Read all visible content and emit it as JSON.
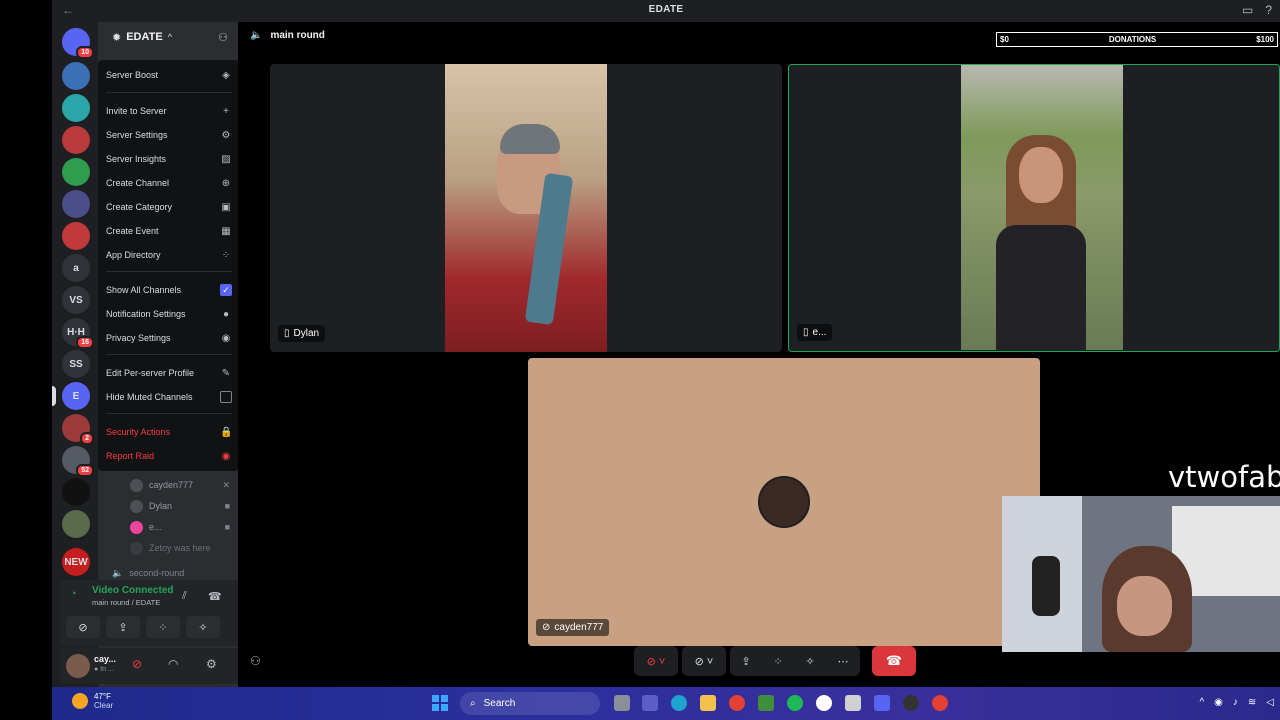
{
  "titlebar": {
    "title": "EDATE",
    "back": "←",
    "forward": "→",
    "inbox_icon": "inbox-icon",
    "help": "?"
  },
  "guilds": {
    "items": [
      {
        "label": "",
        "badge": "10",
        "color": "#5865f2"
      },
      {
        "label": "",
        "color": "#3b6fb6"
      },
      {
        "label": "",
        "color": "#2aa6a8"
      },
      {
        "label": "",
        "color": "#b83a3a"
      },
      {
        "label": "",
        "color": "#2e9e4e"
      },
      {
        "label": "",
        "color": "#4a4f8a"
      },
      {
        "label": "",
        "color": "#c23b3b"
      },
      {
        "label": "a"
      },
      {
        "label": "VS"
      },
      {
        "label": "H·H",
        "badge": "16"
      },
      {
        "label": "SS"
      },
      {
        "label": "E",
        "color": "#5865f2"
      },
      {
        "label": "",
        "badge": "2",
        "color": "#9c3a3a"
      },
      {
        "label": "",
        "badge": "52",
        "color": "#555a65"
      },
      {
        "label": "",
        "color": "#111"
      },
      {
        "label": "",
        "color": "#5a6b4a"
      },
      {
        "label": "NEW",
        "color": "#c41e1e"
      }
    ]
  },
  "server": {
    "name": "EDATE",
    "caret": "^"
  },
  "menu": {
    "items": [
      {
        "label": "Server Boost",
        "icon": "◈"
      },
      {
        "label": "Invite to Server",
        "icon": "+"
      },
      {
        "label": "Server Settings",
        "icon": "⚙"
      },
      {
        "label": "Server Insights",
        "icon": "▨"
      },
      {
        "label": "Create Channel",
        "icon": "⊕"
      },
      {
        "label": "Create Category",
        "icon": "▣"
      },
      {
        "label": "Create Event",
        "icon": "▦"
      },
      {
        "label": "App Directory",
        "icon": "⁘"
      },
      {
        "label": "Show All Channels",
        "checked": true
      },
      {
        "label": "Notification Settings",
        "icon": "●"
      },
      {
        "label": "Privacy Settings",
        "icon": "◉"
      },
      {
        "label": "Edit Per-server Profile",
        "icon": "✎"
      },
      {
        "label": "Hide Muted Channels",
        "checked": false
      },
      {
        "label": "Security Actions",
        "icon": "🔒"
      },
      {
        "label": "Report Raid",
        "icon": "◉"
      }
    ]
  },
  "voice_users": [
    {
      "name": "cayden777",
      "icon": "✕"
    },
    {
      "name": "Dylan",
      "icon": "■"
    },
    {
      "name": "e...",
      "icon": "■"
    },
    {
      "name": "Zetoy was here",
      "icon": ""
    }
  ],
  "next_channel": "second-round",
  "voice_panel": {
    "status": "Video Connected",
    "sub": "main round / EDATE",
    "buttons": [
      "⊘",
      "⇪",
      "⁘",
      "✧"
    ]
  },
  "user_panel": {
    "name": "cay...",
    "status": "● In ..."
  },
  "call": {
    "channel": "main round",
    "donation": {
      "left": "$0",
      "center": "DONATIONS",
      "right": "$100"
    },
    "tiles": [
      {
        "name": "Dylan"
      },
      {
        "name": "e..."
      },
      {
        "name": "cayden777"
      }
    ],
    "overlay_name": "vtwofab"
  },
  "taskbar": {
    "temp": "47°F",
    "condition": "Clear",
    "search_placeholder": "Search"
  }
}
